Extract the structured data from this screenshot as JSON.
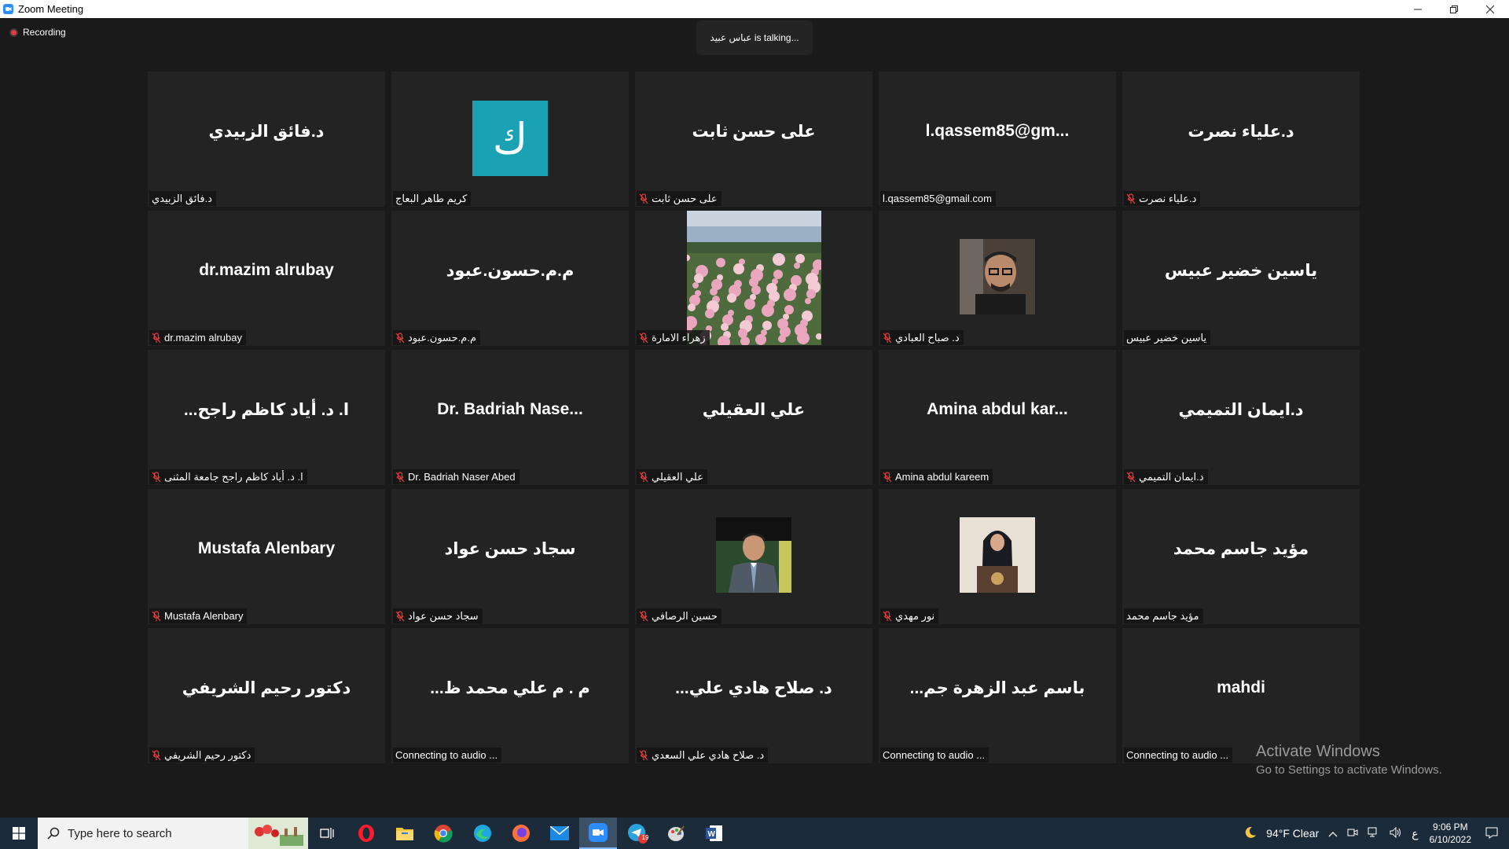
{
  "window": {
    "title": "Zoom Meeting"
  },
  "recording": {
    "label": "Recording"
  },
  "talking": {
    "text": "عباس عبيد is talking..."
  },
  "tiles": [
    {
      "big": "د.فائق الزبيدي",
      "label": "د.فائق الزبيدي",
      "muted": false
    },
    {
      "big": "",
      "avatar_letter": "ك",
      "label": "كريم طاهر البعاج",
      "muted": false
    },
    {
      "big": "على حسن ثابت",
      "label": "على حسن ثابت",
      "muted": true
    },
    {
      "big": "l.qassem85@gm...",
      "label": "l.qassem85@gmail.com",
      "muted": false
    },
    {
      "big": "د.علياء نصرت",
      "label": "د.علياء نصرت",
      "muted": true
    },
    {
      "big": "dr.mazim alrubay",
      "label": "dr.mazim alrubay",
      "muted": true
    },
    {
      "big": "م.م.حسون.عبود",
      "label": "م.م.حسون.عبود",
      "muted": true
    },
    {
      "big": "",
      "photo": "flowers",
      "label": "زهراء الامارة",
      "muted": true
    },
    {
      "big": "",
      "photo": "man-glasses",
      "label": "د. صباح العبادي",
      "muted": true
    },
    {
      "big": "ياسين خضير عبيس",
      "label": "ياسين خضير عبيس",
      "muted": false
    },
    {
      "big": "...ا. د. أياد كاظم راجح",
      "label": "ا. د. أياد كاظم راجح جامعة المثنى",
      "muted": true
    },
    {
      "big": "Dr. Badriah Nase...",
      "label": "Dr. Badriah Naser Abed",
      "muted": true
    },
    {
      "big": "علي العقيلي",
      "label": "علي العقيلي",
      "muted": true
    },
    {
      "big": "Amina abdul kar...",
      "label": "Amina abdul kareem",
      "muted": true
    },
    {
      "big": "د.ايمان التميمي",
      "label": "د.ايمان التميمي",
      "muted": true
    },
    {
      "big": "Mustafa Alenbary",
      "label": "Mustafa Alenbary",
      "muted": true
    },
    {
      "big": "سجاد حسن عواد",
      "label": "سجاد حسن عواد",
      "muted": true
    },
    {
      "big": "",
      "photo": "man-suit",
      "label": "حسين الرصافي",
      "muted": true
    },
    {
      "big": "",
      "photo": "woman-podium",
      "label": "نور مهدي",
      "muted": true
    },
    {
      "big": "مؤيد جاسم محمد",
      "label": "مؤيد جاسم محمد",
      "muted": false
    },
    {
      "big": "دكتور رحيم الشريفي",
      "label": "دكتور رحيم الشريفي",
      "muted": true
    },
    {
      "big": "...م . م علي محمد ظ",
      "label": "Connecting to audio ...",
      "muted": false
    },
    {
      "big": "...د. صلاح هادي علي",
      "label": "د. صلاح هادي علي السعدي",
      "muted": true
    },
    {
      "big": "...باسم عبد الزهرة جم",
      "label": "Connecting to audio ...",
      "muted": false
    },
    {
      "big": "mahdi",
      "label": "Connecting to audio ...",
      "muted": false
    }
  ],
  "activate": {
    "line1": "Activate Windows",
    "line2": "Go to Settings to activate Windows."
  },
  "taskbar": {
    "search_placeholder": "Type here to search",
    "weather": "94°F  Clear",
    "time": "9:06 PM",
    "date": "6/10/2022",
    "lang": "ع",
    "telegram_badge": "19"
  }
}
